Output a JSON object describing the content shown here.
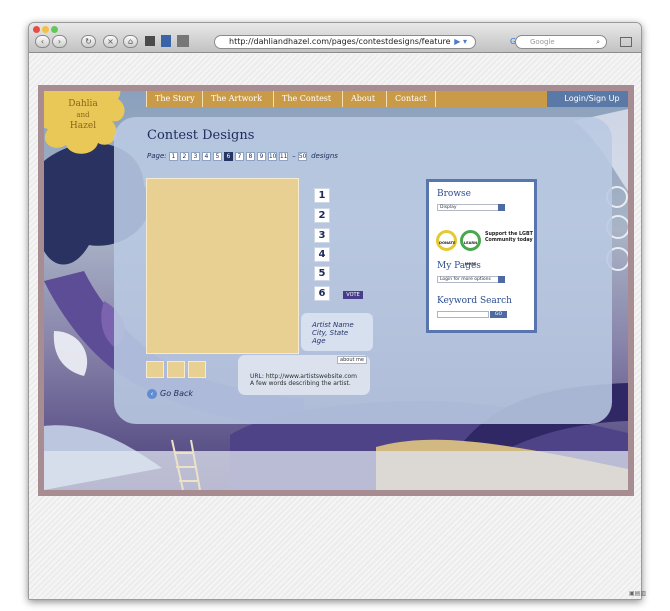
{
  "browser": {
    "url": "http://dahliandhazel.com/pages/contestdesigns/feature",
    "search_placeholder": "Google",
    "nav_icons": [
      "back-icon",
      "forward-icon",
      "refresh-icon",
      "stop-icon",
      "home-icon"
    ]
  },
  "site": {
    "logo_text": "Dahlia and Hazel",
    "nav": [
      {
        "label": "The Story"
      },
      {
        "label": "The Artwork"
      },
      {
        "label": "The Contest"
      },
      {
        "label": "About"
      },
      {
        "label": "Contact"
      }
    ],
    "login_label": "Login/Sign Up"
  },
  "contest": {
    "title": "Contest Designs",
    "page_label": "Page",
    "pages": [
      "1",
      "2",
      "3",
      "4",
      "5",
      "6",
      "7",
      "8",
      "9",
      "10",
      "11"
    ],
    "current_page": "6",
    "total": "50",
    "total_label": "designs",
    "numbers": [
      "1",
      "2",
      "3",
      "4",
      "5",
      "6"
    ],
    "vote_label": "VOTE",
    "artist_name": "Artist Name",
    "artist_city": "City, State",
    "artist_age": "Age",
    "about_label": "about me",
    "about_url": "URL: http://www.artistswebsite.com",
    "about_text": "A few words describing the artist.",
    "go_back_label": "Go Back"
  },
  "sidebar": {
    "browse_title": "Browse",
    "browse_value": "Display",
    "donate_label": "DONATE",
    "learn_label": "LEARN MORE",
    "support_text": "Support the LGBT Community today",
    "mypages_title": "My Pages",
    "mypages_value": "Login for more options",
    "keyword_title": "Keyword Search",
    "search_button": "GO"
  },
  "colors": {
    "nav": "#c99b49",
    "login": "#5b79a7",
    "title": "#1d2b5a",
    "swatch": "#e8cf92",
    "sidebar_border": "#5876ad"
  }
}
